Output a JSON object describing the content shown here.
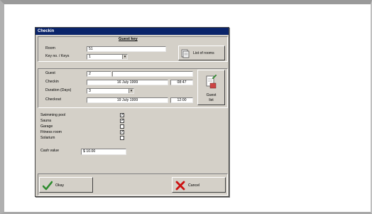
{
  "dialog": {
    "title": "Checkin",
    "section_title": "Guest key",
    "room_label": "Room",
    "room_value": "51",
    "keyno_label": "Key no. / Keys",
    "keyno_value": "1",
    "list_rooms_button": "List of rooms",
    "guest_label": "Guest",
    "guest_value": "2",
    "checkin_label": "Checkin",
    "checkin_date": "16 July 1999",
    "checkin_time": "08:47",
    "duration_label": "Duration (Days)",
    "duration_value": "3",
    "checkout_label": "Checkout",
    "checkout_date": "19 July 1999",
    "checkout_time": "12:00",
    "guest_list_button_line1": "Guest",
    "guest_list_button_line2": "list",
    "facilities": [
      {
        "label": "Swimming pool",
        "checked": true,
        "mark": "✓"
      },
      {
        "label": "Sauna",
        "checked": true,
        "mark": "✓"
      },
      {
        "label": "Garage",
        "checked": false,
        "mark": ""
      },
      {
        "label": "Fitness room",
        "checked": true,
        "mark": "✓"
      },
      {
        "label": "Solarium",
        "checked": false,
        "mark": ""
      }
    ],
    "cash_label": "Cash value",
    "cash_value": "$ 10.00",
    "okay_button": "Okay",
    "cancel_button": "Cancel"
  },
  "colors": {
    "titlebar": "#0a246a",
    "face": "#d4d0c8",
    "okay_icon": "#2e8b2e",
    "cancel_icon": "#cc1111"
  }
}
